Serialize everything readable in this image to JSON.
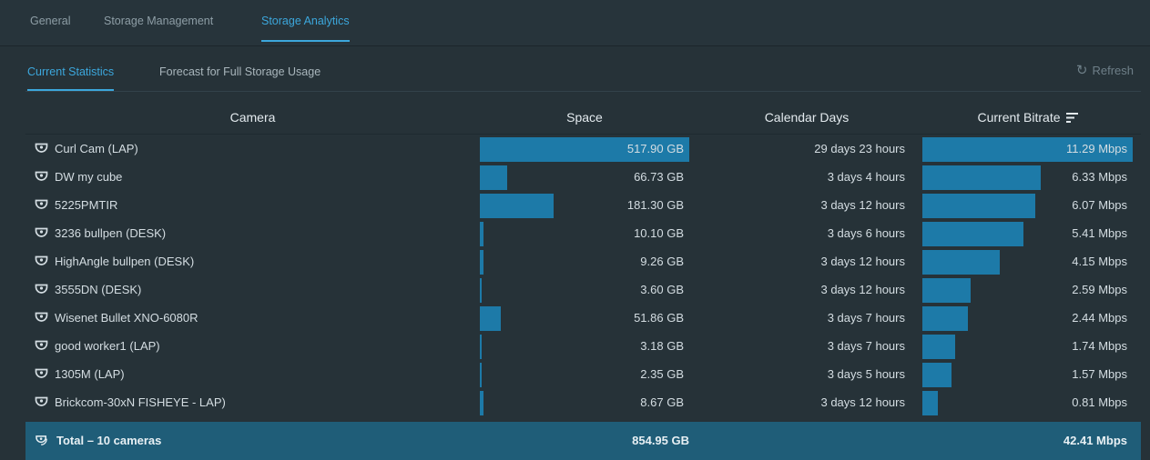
{
  "top_tabs": [
    {
      "label": "General",
      "active": false
    },
    {
      "label": "Storage Management",
      "active": false
    },
    {
      "label": "Storage Analytics",
      "active": true
    }
  ],
  "sub_tabs": [
    {
      "label": "Current Statistics",
      "active": true
    },
    {
      "label": "Forecast for Full Storage Usage",
      "active": false
    }
  ],
  "refresh": {
    "label": "Refresh",
    "icon": "refresh-icon"
  },
  "table": {
    "headers": {
      "camera": "Camera",
      "space": "Space",
      "calendar_days": "Calendar Days",
      "current_bitrate": "Current Bitrate"
    },
    "sort_icon": "sort-descending-icon",
    "rows": [
      {
        "camera": "Curl Cam (LAP)",
        "space": "517.90 GB",
        "space_fraction": 1.0,
        "days": "29 days 23 hours",
        "bitrate": "11.29 Mbps",
        "bitrate_fraction": 1.0
      },
      {
        "camera": "DW my cube",
        "space": "66.73 GB",
        "space_fraction": 0.1288,
        "days": "3 days 4 hours",
        "bitrate": "6.33 Mbps",
        "bitrate_fraction": 0.5607
      },
      {
        "camera": "5225PMTIR",
        "space": "181.30 GB",
        "space_fraction": 0.3501,
        "days": "3 days 12 hours",
        "bitrate": "6.07 Mbps",
        "bitrate_fraction": 0.5376
      },
      {
        "camera": "3236 bullpen (DESK)",
        "space": "10.10 GB",
        "space_fraction": 0.0195,
        "days": "3 days 6 hours",
        "bitrate": "5.41 Mbps",
        "bitrate_fraction": 0.4792
      },
      {
        "camera": "HighAngle bullpen (DESK)",
        "space": "9.26 GB",
        "space_fraction": 0.0179,
        "days": "3 days 12 hours",
        "bitrate": "4.15 Mbps",
        "bitrate_fraction": 0.3676
      },
      {
        "camera": "3555DN (DESK)",
        "space": "3.60 GB",
        "space_fraction": 0.007,
        "days": "3 days 12 hours",
        "bitrate": "2.59 Mbps",
        "bitrate_fraction": 0.2294
      },
      {
        "camera": "Wisenet Bullet XNO-6080R",
        "space": "51.86 GB",
        "space_fraction": 0.1001,
        "days": "3 days 7 hours",
        "bitrate": "2.44 Mbps",
        "bitrate_fraction": 0.2161
      },
      {
        "camera": "good worker1 (LAP)",
        "space": "3.18 GB",
        "space_fraction": 0.0061,
        "days": "3 days 7 hours",
        "bitrate": "1.74 Mbps",
        "bitrate_fraction": 0.1541
      },
      {
        "camera": "1305M (LAP)",
        "space": "2.35 GB",
        "space_fraction": 0.0045,
        "days": "3 days 5 hours",
        "bitrate": "1.57 Mbps",
        "bitrate_fraction": 0.1391
      },
      {
        "camera": "Brickcom-30xN FISHEYE - LAP)",
        "space": "8.67 GB",
        "space_fraction": 0.0167,
        "days": "3 days 12 hours",
        "bitrate": "0.81 Mbps",
        "bitrate_fraction": 0.0717
      }
    ],
    "total": {
      "label": "Total – 10 cameras",
      "space": "854.95 GB",
      "bitrate": "42.41 Mbps",
      "icon": "camera-group-icon"
    }
  },
  "colors": {
    "accent": "#3ca7dc",
    "bar": "#1d7aa8",
    "background": "#263238",
    "total_row": "#1f5d78"
  }
}
